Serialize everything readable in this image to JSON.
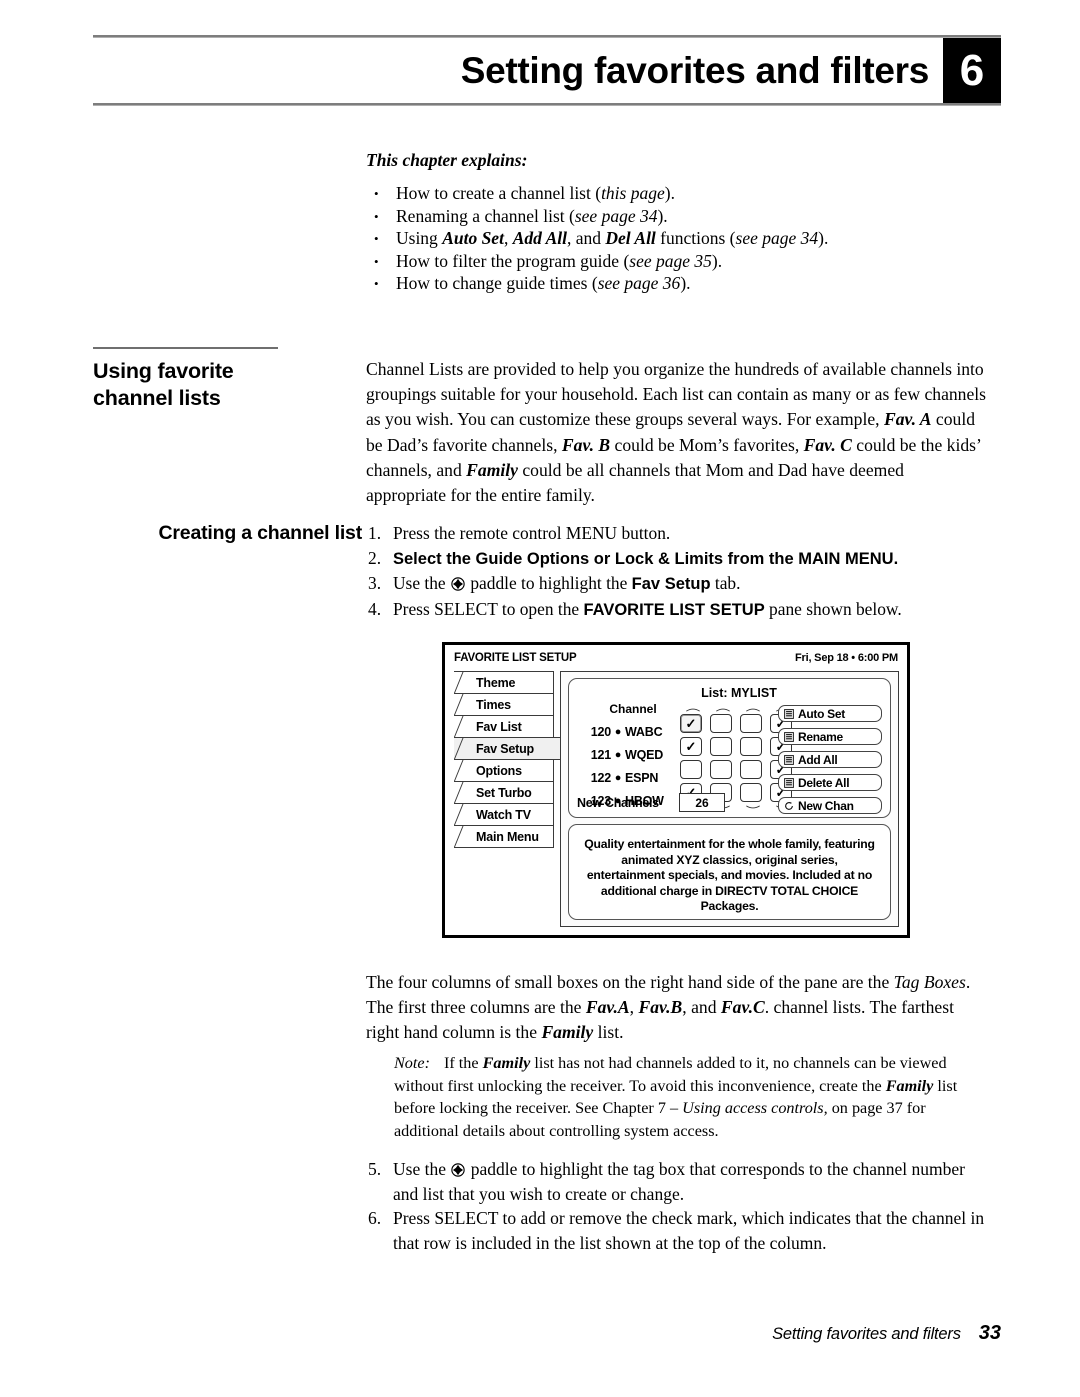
{
  "header": {
    "title": "Setting favorites and filters",
    "number": "6"
  },
  "intro": {
    "heading": "This chapter explains:",
    "bullets": [
      {
        "dot": "•",
        "html": "How to create a channel list (<i>this page</i>)."
      },
      {
        "dot": "•",
        "html": "Renaming a channel list (<i>see page 34</i>)."
      },
      {
        "dot": "•",
        "html": "Using <span class=\"bi\">Auto Set</span>, <span class=\"bi\">Add All</span>, and <span class=\"bi\">Del All</span> functions (<i>see page 34</i>)."
      },
      {
        "dot": "•",
        "html": "How to filter the program guide (<i>see page 35</i>)."
      },
      {
        "dot": "•",
        "html": "How to change guide times (<i>see page 36</i>)."
      }
    ]
  },
  "section": {
    "heading": "Using favorite\nchannel lists",
    "body_html": "Channel Lists are provided to help you organize the hundreds of available channels into groupings suitable for your household. Each list can contain as many or as few channels as you wish. You can customize these groups several ways. For example, <span class=\"bi\">Fav. A</span> could be Dad&rsquo;s favorite channels, <span class=\"bi\">Fav. B</span> could be Mom&rsquo;s favorites, <span class=\"bi\">Fav. C</span> could be the kids&rsquo; channels, and <span class=\"bi\">Family</span> could be all channels that Mom and Dad have deemed appropriate for the entire family."
  },
  "creating": {
    "heading": "Creating a channel list",
    "steps": [
      {
        "num": "1.",
        "html": "Press the remote control MENU button."
      },
      {
        "num": "2.",
        "html": "<span class=\"sans-b\">Select the <b>Guide Options</b> or <b>Lock &amp; Limits</b> from the <b>MAIN MENU</b>.</span>"
      },
      {
        "num": "3.",
        "html": "Use the <span class=\"paddle-icon\" data-name=\"paddle-icon\"></span> paddle to highlight the <span class=\"sans-b\">Fav Setup</span> tab."
      },
      {
        "num": "4.",
        "html": "Press SELECT to open the <span class=\"sans-b\">FAVORITE LIST SETUP</span> pane shown below."
      }
    ]
  },
  "tv_screen": {
    "title": "FAVORITE LIST SETUP",
    "clock": "Fri, Sep 18  •  6:00 PM",
    "tabs": [
      {
        "label": "Theme",
        "selected": false
      },
      {
        "label": "Times",
        "selected": false
      },
      {
        "label": "Fav List",
        "selected": false
      },
      {
        "label": "Fav Setup",
        "selected": true
      },
      {
        "label": "Options",
        "selected": false
      },
      {
        "label": "Set Turbo",
        "selected": false
      },
      {
        "label": "Watch TV",
        "selected": false
      },
      {
        "label": "Main Menu",
        "selected": false
      }
    ],
    "list_label": "List:  MYLIST",
    "channel_header": "Channel",
    "channels": [
      {
        "number": "120",
        "dot": "●",
        "name": "WABC",
        "tags": [
          true,
          false,
          false,
          true
        ]
      },
      {
        "number": "121",
        "dot": "●",
        "name": "WQED",
        "tags": [
          true,
          false,
          false,
          true
        ]
      },
      {
        "number": "122",
        "dot": "●",
        "name": "ESPN",
        "tags": [
          false,
          false,
          false,
          true
        ]
      },
      {
        "number": "123",
        "dot": "●",
        "name": "HBOW",
        "tags": [
          true,
          false,
          false,
          true
        ]
      }
    ],
    "check_glyph": "✓",
    "new_channels_label": "New Channels",
    "new_channels_value": "26",
    "buttons": [
      {
        "label": "Auto Set",
        "icon": "list-icon"
      },
      {
        "label": "Rename",
        "icon": "list-icon"
      },
      {
        "label": "Add All",
        "icon": "list-icon"
      },
      {
        "label": "Delete All",
        "icon": "list-icon"
      },
      {
        "label": "New Chan",
        "icon": "refresh-icon"
      }
    ],
    "description": "Quality entertainment for the whole family, featuring animated XYZ classics, original series, entertainment specials, and movies. Included at no additional charge in DIRECTV TOTAL CHOICE Packages."
  },
  "tagbox_para": {
    "html": "The four columns of small boxes on the right hand side of the pane are the <i>Tag Boxes</i>. The first three columns are the <span class=\"bi\">Fav.A</span>, <span class=\"bi\">Fav.B</span>, and <span class=\"bi\">Fav.C</span>. channel lists. The farthest right hand column is the <span class=\"bi\">Family</span> list."
  },
  "note": {
    "label": "Note:",
    "html": "If the <span class=\"bi\">Family</span> list has not had channels added to it, no channels can be viewed without first unlocking the receiver. To avoid this inconvenience, create the <span class=\"bi\">Family</span> list before locking the receiver. See Chapter 7 &ndash; <i>Using access controls,</i> on page 37 for additional details about controlling system access."
  },
  "steps_bottom": [
    {
      "num": "5.",
      "html": "Use the <span class=\"paddle-icon\" data-name=\"paddle-icon\"></span> paddle to highlight the tag box that corresponds to the channel number and list that you wish to create or change."
    },
    {
      "num": "6.",
      "html": "Press SELECT to add or remove the check mark, which indicates that the channel in that row is included in the list shown at the top of the column."
    }
  ],
  "footer": {
    "title": "Setting favorites and filters",
    "page": "33"
  },
  "colors": {
    "ink": "#000000",
    "rule": "#6f6f6f",
    "tab_selected_bg": "#f0f0f0"
  }
}
